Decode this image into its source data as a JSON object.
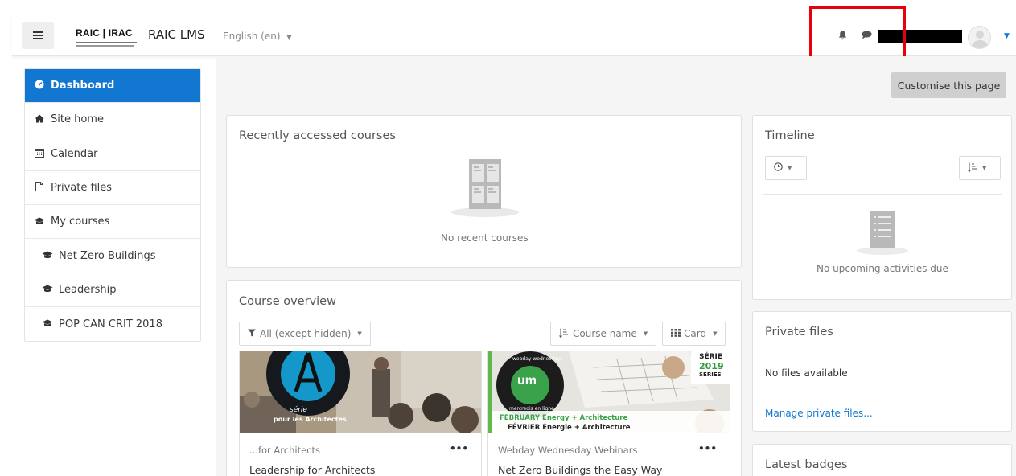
{
  "navbar": {
    "logo_text": "RAIC | IRAC",
    "site_name": "RAIC LMS",
    "language": "English (en)",
    "language_caret": "▼",
    "bell_icon": "bell-icon",
    "chat_icon": "chat-icon",
    "user_caret": "▼",
    "accent_color": "#1177d1",
    "highlight_color": "#e8000b"
  },
  "sidebar": {
    "items": [
      {
        "label": "Dashboard",
        "icon": "dashboard-icon",
        "glyph": "◐",
        "active": true
      },
      {
        "label": "Site home",
        "icon": "home-icon",
        "glyph": "⌂"
      },
      {
        "label": "Calendar",
        "icon": "calendar-icon",
        "glyph": "▦"
      },
      {
        "label": "Private files",
        "icon": "file-icon",
        "glyph": "▯"
      },
      {
        "label": "My courses",
        "icon": "graduation-cap-icon",
        "glyph": "🎓"
      },
      {
        "label": "Net Zero Buildings",
        "icon": "graduation-cap-icon",
        "glyph": "🎓"
      },
      {
        "label": "Leadership",
        "icon": "graduation-cap-icon",
        "glyph": "🎓"
      },
      {
        "label": "POP CAN CRIT 2018",
        "icon": "graduation-cap-icon",
        "glyph": "🎓"
      }
    ]
  },
  "main": {
    "customise_label": "Customise this page",
    "recent": {
      "title": "Recently accessed courses",
      "empty_text": "No recent courses"
    },
    "overview": {
      "title": "Course overview",
      "filter_label": "All (except hidden)",
      "sort_label": "Course name",
      "view_label": "Card",
      "caret": "▼",
      "courses": [
        {
          "category": "...for Architects",
          "name": "Leadership for Architects",
          "more": "•••",
          "img_text_1": "série",
          "img_text_2": "pour les Architectes"
        },
        {
          "category": "Webday Wednesday Webinars",
          "name": "Net Zero Buildings the Easy Way",
          "more": "•••",
          "img_text_1": "SÉRIE",
          "img_text_2": "2019",
          "img_text_3": "SERIES",
          "img_text_4": "FEBRUARY Energy + Architecture",
          "img_text_5": "FÉVRIER Énergie + Architecture",
          "img_text_6": "um",
          "img_text_7": "webday wednesdays",
          "img_text_8": "mercredis en ligne"
        }
      ]
    }
  },
  "timeline": {
    "title": "Timeline",
    "filter_icon": "clock-icon",
    "sort_icon": "sort-icon",
    "caret": "▼",
    "empty_text": "No upcoming activities due"
  },
  "private_files": {
    "title": "Private files",
    "empty_text": "No files available",
    "manage_link": "Manage private files..."
  },
  "badges": {
    "title": "Latest badges"
  }
}
